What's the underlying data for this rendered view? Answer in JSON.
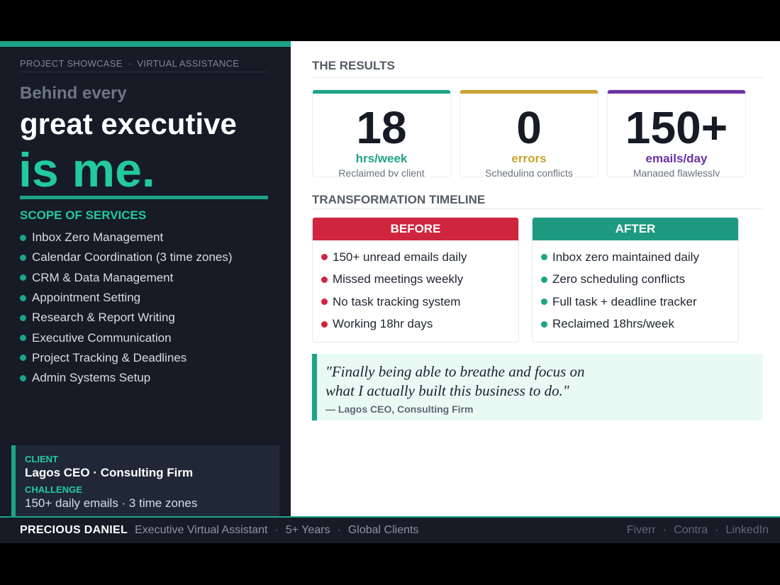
{
  "colors": {
    "accent_teal": "#1da487",
    "before_red": "#d0253e",
    "gold": "#c9a330",
    "purple": "#6a32a5",
    "dark": "#161b26"
  },
  "eyebrow": {
    "left": "PROJECT SHOWCASE",
    "sep": "·",
    "right": "VIRTUAL ASSISTANCE"
  },
  "hero": {
    "line1": "Behind every",
    "line2": "great executive",
    "line3": "is me."
  },
  "scope": {
    "title": "SCOPE OF SERVICES",
    "items": [
      "Inbox Zero Management",
      "Calendar Coordination (3 time zones)",
      "CRM & Data Management",
      "Appointment Setting",
      "Research & Report Writing",
      "Executive Communication",
      "Project Tracking & Deadlines",
      "Admin Systems Setup"
    ]
  },
  "client_card": {
    "client_label": "CLIENT",
    "client_value": "Lagos CEO · Consulting Firm",
    "challenge_label": "CHALLENGE",
    "challenge_line1": "150+ daily emails · 3 time zones"
  },
  "footer": {
    "name": "PRECIOUS DANIEL",
    "items": [
      "Executive Virtual Assistant",
      "5+ Years",
      "Global Clients"
    ],
    "sep": "·",
    "links": [
      "Fiverr",
      "Contra",
      "LinkedIn"
    ]
  },
  "results": {
    "title": "THE RESULTS",
    "stats": [
      {
        "number": "18",
        "unit": "hrs/week",
        "caption": "Reclaimed by client",
        "color": "#1da487"
      },
      {
        "number": "0",
        "unit": "errors",
        "caption": "Scheduling conflicts",
        "color": "#c9a330"
      },
      {
        "number": "150+",
        "unit": "emails/day",
        "caption": "Managed flawlessly",
        "color": "#6a32a5"
      }
    ]
  },
  "timeline": {
    "title": "TRANSFORMATION TIMELINE",
    "before": {
      "label": "BEFORE",
      "items": [
        "150+ unread emails daily",
        "Missed meetings weekly",
        "No task tracking system",
        "Working 18hr days"
      ]
    },
    "after": {
      "label": "AFTER",
      "items": [
        "Inbox zero maintained daily",
        "Zero scheduling conflicts",
        "Full task + deadline tracker",
        "Reclaimed 18hrs/week"
      ]
    }
  },
  "quote": {
    "line1": "\"Finally being able to breathe and focus on",
    "line2": "what I actually built this business to do.\"",
    "attribution": "— Lagos CEO, Consulting Firm"
  }
}
